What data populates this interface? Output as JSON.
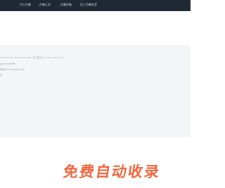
{
  "nav": {
    "items": [
      {
        "label": "百人百善"
      },
      {
        "label": "百善之声"
      },
      {
        "label": "百善声像"
      },
      {
        "label": "百人百善学堂"
      }
    ]
  },
  "footer": {
    "lines": [
      "2022 Powered by EJEOR.COM · 百人百善 All Rights Reserved",
      "备12001287号",
      "网安备000000000001号",
      "站"
    ]
  },
  "promo": {
    "text": "免费自动收录"
  }
}
